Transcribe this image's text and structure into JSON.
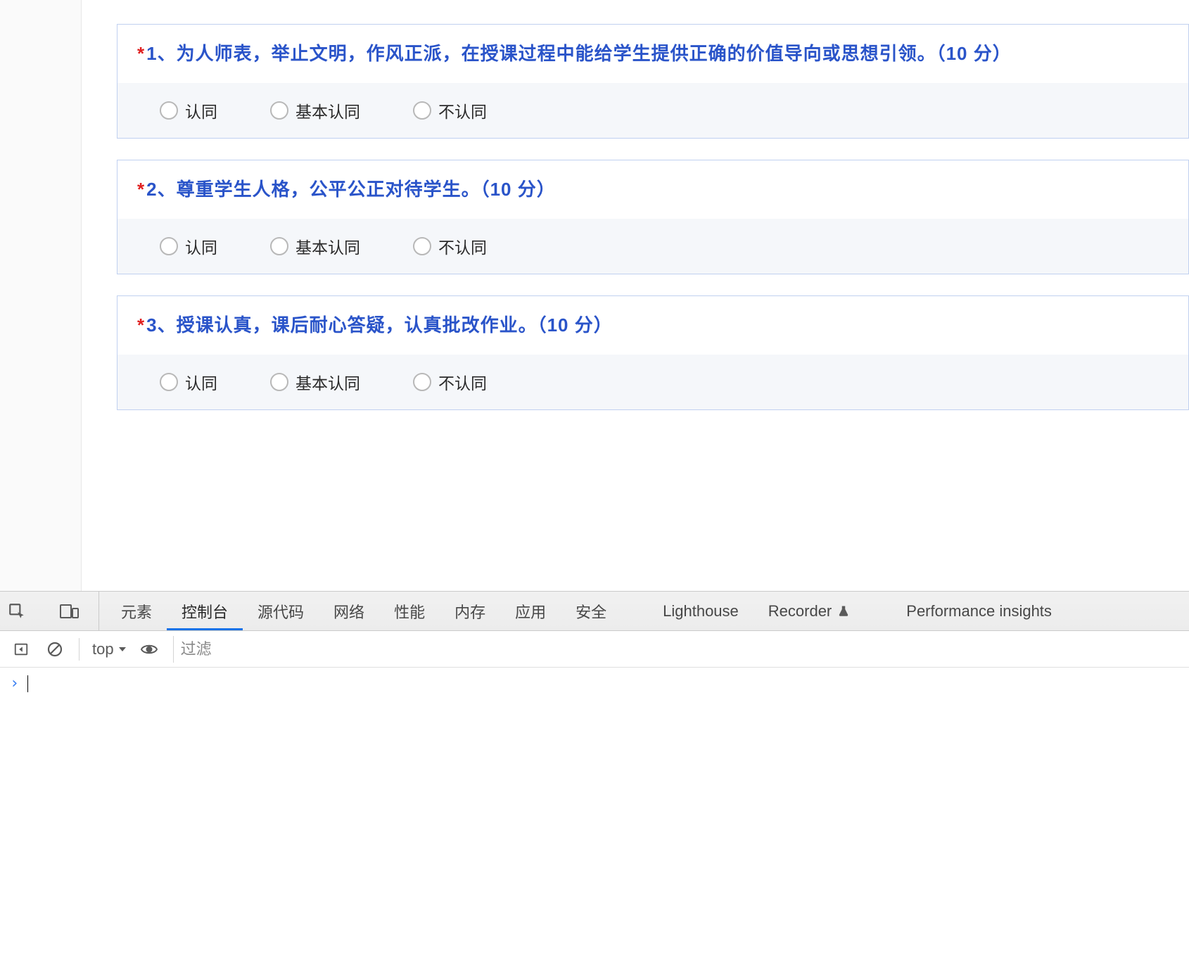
{
  "required_mark": "*",
  "questions": [
    {
      "title": "1、为人师表，举止文明，作风正派，在授课过程中能给学生提供正确的价值导向或思想引领。（10 分）",
      "options": [
        "认同",
        "基本认同",
        "不认同"
      ]
    },
    {
      "title": "2、尊重学生人格，公平公正对待学生。（10 分）",
      "options": [
        "认同",
        "基本认同",
        "不认同"
      ]
    },
    {
      "title": "3、授课认真，课后耐心答疑，认真批改作业。（10 分）",
      "options": [
        "认同",
        "基本认同",
        "不认同"
      ]
    }
  ],
  "devtools": {
    "tabs": {
      "elements": "元素",
      "console": "控制台",
      "sources": "源代码",
      "network": "网络",
      "performance": "性能",
      "memory": "内存",
      "application": "应用",
      "security": "安全",
      "lighthouse": "Lighthouse",
      "recorder": "Recorder",
      "perfinsights": "Performance insights"
    },
    "console_toolbar": {
      "context": "top",
      "filter_placeholder": "过滤"
    }
  }
}
